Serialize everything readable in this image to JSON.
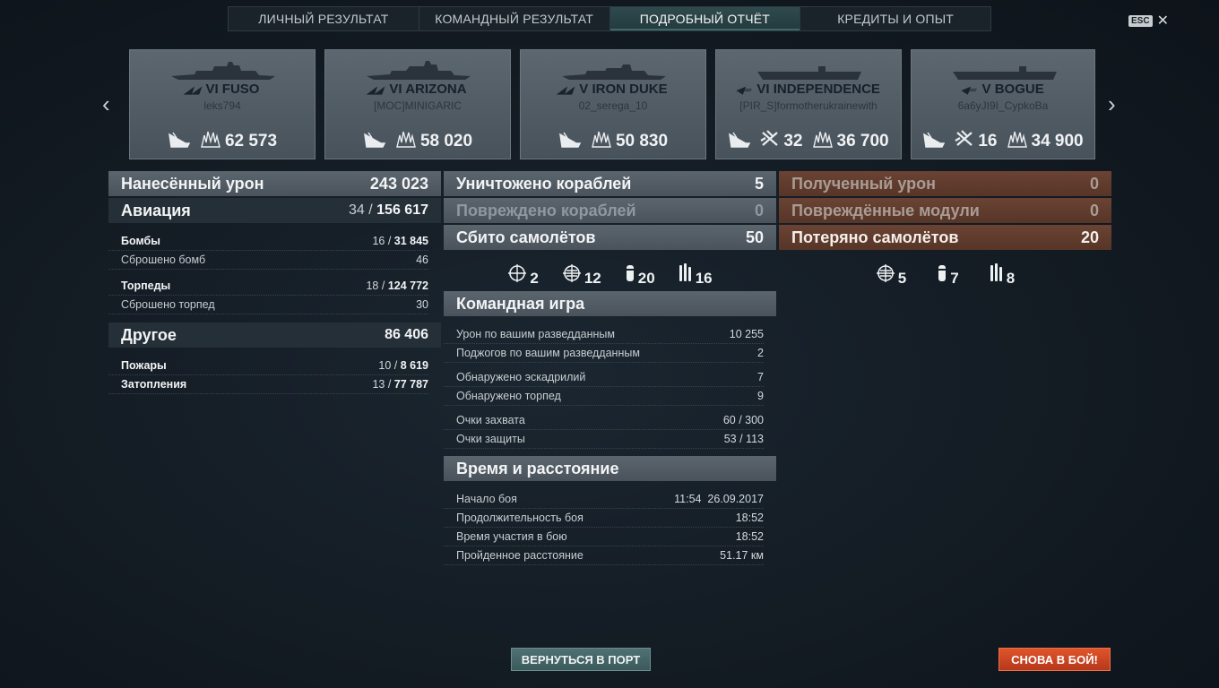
{
  "tabs": [
    {
      "label": "ЛИЧНЫЙ РЕЗУЛЬТАТ",
      "active": false
    },
    {
      "label": "КОМАНДНЫЙ РЕЗУЛЬТАТ",
      "active": false
    },
    {
      "label": "ПОДРОБНЫЙ ОТЧЁТ",
      "active": true
    },
    {
      "label": "КРЕДИТЫ И ОПЫТ",
      "active": false
    }
  ],
  "close": {
    "key": "ESC",
    "icon": "close-icon"
  },
  "ships": [
    {
      "tier": "VI",
      "name": "FUSO",
      "player": "leks794",
      "planes": "",
      "damage": "62 573"
    },
    {
      "tier": "VI",
      "name": "ARIZONA",
      "player": "[MOC]MINIGARIC",
      "planes": "",
      "damage": "58 020"
    },
    {
      "tier": "V",
      "name": "IRON DUKE",
      "player": "02_serega_10",
      "planes": "",
      "damage": "50 830"
    },
    {
      "tier": "VI",
      "name": "INDEPENDENCE",
      "player": "[PIR_S]formotherukrainewith",
      "planes": "32",
      "damage": "36 700"
    },
    {
      "tier": "V",
      "name": "BOGUE",
      "player": "6a6yJI9I_CypkoBa",
      "planes": "16",
      "damage": "34 900"
    }
  ],
  "damage": {
    "title": "Нанесённый урон",
    "total": "243 023",
    "aviation": {
      "label": "Авиация",
      "hits": "34",
      "value": "156 617"
    },
    "bombs": {
      "label": "Бомбы",
      "hits": "16",
      "value": "31 845"
    },
    "bombs_dropped": {
      "label": "Сброшено бомб",
      "value": "46"
    },
    "torps": {
      "label": "Торпеды",
      "hits": "18",
      "value": "124 772"
    },
    "torps_dropped": {
      "label": "Сброшено торпед",
      "value": "30"
    },
    "other": {
      "label": "Другое",
      "value": "86 406"
    },
    "fires": {
      "label": "Пожары",
      "hits": "10",
      "value": "8 619"
    },
    "floods": {
      "label": "Затопления",
      "hits": "13",
      "value": "77 787"
    }
  },
  "middle": {
    "destroyed": {
      "label": "Уничтожено кораблей",
      "value": "5"
    },
    "damaged": {
      "label": "Повреждено кораблей",
      "value": "0"
    },
    "planes_down": {
      "label": "Сбито самолётов",
      "value": "50"
    },
    "icons": [
      {
        "icon": "fighter-icon",
        "value": "2"
      },
      {
        "icon": "fighter-squadron-icon",
        "value": "12"
      },
      {
        "icon": "dive-bomber-icon",
        "value": "20"
      },
      {
        "icon": "torpedo-bomber-icon",
        "value": "16"
      }
    ],
    "team": {
      "title": "Командная игра",
      "rows": [
        {
          "label": "Урон по вашим разведданным",
          "value": "10 255"
        },
        {
          "label": "Поджогов по вашим разведданным",
          "value": "2"
        },
        {
          "label": "Обнаружено эскадрилий",
          "value": "7"
        },
        {
          "label": "Обнаружено торпед",
          "value": "9"
        },
        {
          "label": "Очки захвата",
          "value": "60 / 300"
        },
        {
          "label": "Очки защиты",
          "value": "53 / 113"
        }
      ]
    },
    "time": {
      "title": "Время и расстояние",
      "rows": [
        {
          "label": "Начало боя",
          "value": "11:54  26.09.2017"
        },
        {
          "label": "Продолжительность боя",
          "value": "18:52"
        },
        {
          "label": "Время участия в бою",
          "value": "18:52"
        },
        {
          "label": "Пройденное расстояние",
          "value": "51.17 км"
        }
      ]
    }
  },
  "received": {
    "damage": {
      "label": "Полученный урон",
      "value": "0"
    },
    "modules": {
      "label": "Повреждённые модули",
      "value": "0"
    },
    "planes_lost": {
      "label": "Потеряно самолётов",
      "value": "20"
    },
    "icons": [
      {
        "icon": "fighter-squadron-icon",
        "value": "5"
      },
      {
        "icon": "dive-bomber-icon",
        "value": "7"
      },
      {
        "icon": "torpedo-bomber-icon",
        "value": "8"
      }
    ]
  },
  "buttons": {
    "port": "ВЕРНУТЬСЯ В ПОРТ",
    "battle": "СНОВА В БОЙ!"
  }
}
